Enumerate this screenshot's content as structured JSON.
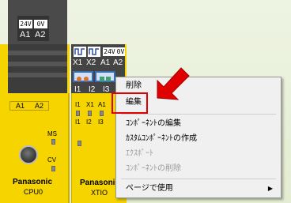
{
  "cpu": {
    "terminal_labels": [
      "24V",
      "0V"
    ],
    "terminal_names": [
      "A1",
      "A2"
    ],
    "io_labels": [
      "A1",
      "A2"
    ],
    "leds": [
      "MS",
      "CV"
    ],
    "brand": "Panasonic",
    "model": "CPU0"
  },
  "xtio": {
    "top_names": [
      "X1",
      "X2",
      "A1",
      "A2"
    ],
    "top_terminal_labels": [
      "24V",
      "0V"
    ],
    "input_names": [
      "I1",
      "I2",
      "I3"
    ],
    "io_row1": [
      "I1",
      "X1",
      "A1"
    ],
    "io_row2": [
      "I1",
      "I2",
      "I3"
    ],
    "led_label": "MS",
    "brand": "Panasonic",
    "model": "XTIO"
  },
  "context_menu": {
    "items": [
      {
        "label": "削除",
        "enabled": true
      },
      {
        "label": "編集",
        "enabled": true
      },
      {
        "label": "ｺﾝﾎﾟｰﾈﾝﾄの編集",
        "enabled": true
      },
      {
        "label": "ｶｽﾀﾑｺﾝﾎﾟｰﾈﾝﾄの作成",
        "enabled": true
      },
      {
        "label": "ｴｸｽﾎﾟｰﾄ",
        "enabled": false
      },
      {
        "label": "ｺﾝﾎﾟｰﾈﾝﾄの削除",
        "enabled": false
      },
      {
        "label": "ページで使用",
        "enabled": true,
        "has_submenu": true
      }
    ],
    "highlighted_item": "編集"
  },
  "colors": {
    "module_yellow": "#f5d400",
    "highlight_red": "#e00000",
    "arrow_red": "#e00000"
  }
}
